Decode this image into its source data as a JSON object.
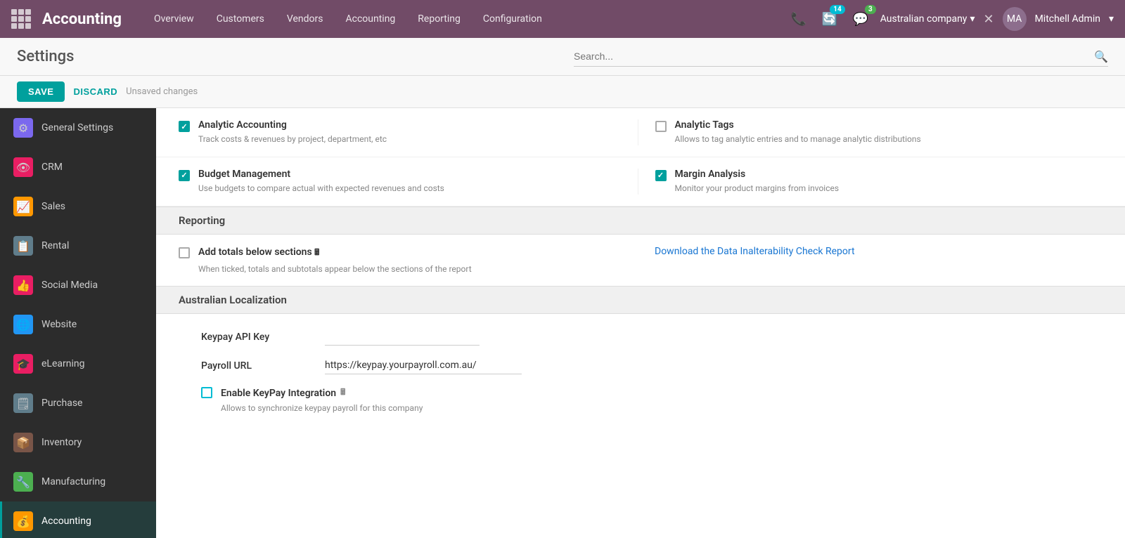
{
  "navbar": {
    "brand": "Accounting",
    "menu_items": [
      "Overview",
      "Customers",
      "Vendors",
      "Accounting",
      "Reporting",
      "Configuration"
    ],
    "notifications_count": "14",
    "messages_count": "3",
    "company": "Australian company",
    "username": "Mitchell Admin"
  },
  "subheader": {
    "title": "Settings",
    "search_placeholder": "Search..."
  },
  "actionbar": {
    "save_label": "SAVE",
    "discard_label": "DISCARD",
    "unsaved_label": "Unsaved changes"
  },
  "sidebar": {
    "items": [
      {
        "id": "general-settings",
        "label": "General Settings",
        "icon": "⚙",
        "color": "icon-general"
      },
      {
        "id": "crm",
        "label": "CRM",
        "icon": "👁",
        "color": "icon-crm"
      },
      {
        "id": "sales",
        "label": "Sales",
        "icon": "📈",
        "color": "icon-sales"
      },
      {
        "id": "rental",
        "label": "Rental",
        "icon": "📋",
        "color": "icon-rental"
      },
      {
        "id": "social-media",
        "label": "Social Media",
        "icon": "👍",
        "color": "icon-social"
      },
      {
        "id": "website",
        "label": "Website",
        "icon": "🌐",
        "color": "icon-website"
      },
      {
        "id": "elearning",
        "label": "eLearning",
        "icon": "🎓",
        "color": "icon-elearning"
      },
      {
        "id": "purchase",
        "label": "Purchase",
        "icon": "🗒",
        "color": "icon-purchase"
      },
      {
        "id": "inventory",
        "label": "Inventory",
        "icon": "📦",
        "color": "icon-inventory"
      },
      {
        "id": "manufacturing",
        "label": "Manufacturing",
        "icon": "🔧",
        "color": "icon-manufacturing"
      },
      {
        "id": "accounting",
        "label": "Accounting",
        "icon": "💰",
        "color": "icon-accounting",
        "active": true
      }
    ]
  },
  "content": {
    "sections": [
      {
        "id": "analytics",
        "settings": [
          {
            "id": "analytic-accounting",
            "checked": true,
            "title": "Analytic Accounting",
            "desc": "Track costs & revenues by project, department, etc"
          },
          {
            "id": "analytic-tags",
            "checked": false,
            "title": "Analytic Tags",
            "desc": "Allows to tag analytic entries and to manage analytic distributions"
          }
        ]
      },
      {
        "id": "budget",
        "settings": [
          {
            "id": "budget-management",
            "checked": true,
            "title": "Budget Management",
            "desc": "Use budgets to compare actual with expected revenues and costs"
          },
          {
            "id": "margin-analysis",
            "checked": true,
            "title": "Margin Analysis",
            "desc": "Monitor your product margins from invoices"
          }
        ]
      }
    ],
    "reporting": {
      "section_title": "Reporting",
      "add_totals": {
        "id": "add-totals",
        "checked": false,
        "title": "Add totals below sections",
        "desc": "When ticked, totals and subtotals appear below the sections of the report"
      },
      "link_label": "Download the Data Inalterability Check Report"
    },
    "localization": {
      "section_title": "Australian Localization",
      "fields": [
        {
          "label": "Keypay API Key",
          "value": "",
          "type": "input"
        },
        {
          "label": "Payroll URL",
          "value": "https://keypay.yourpayroll.com.au/",
          "type": "text"
        }
      ],
      "enable_keypay": {
        "id": "enable-keypay",
        "checked": false,
        "checked_type": "cyan",
        "title": "Enable KeyPay Integration",
        "desc": "Allows to synchronize keypay payroll for this company",
        "has_icon": true
      }
    }
  }
}
